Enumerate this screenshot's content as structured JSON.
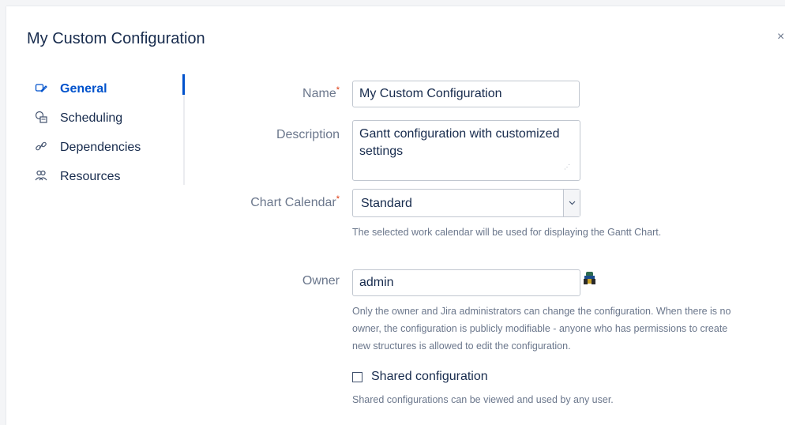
{
  "dialog": {
    "title": "My Custom Configuration",
    "close_glyph": "×"
  },
  "nav": {
    "items": [
      {
        "label": "General",
        "icon": "settings-pen-icon",
        "glyph": "⚙",
        "active": true
      },
      {
        "label": "Scheduling",
        "icon": "calendar-clock-icon",
        "glyph": "⏲"
      },
      {
        "label": "Dependencies",
        "icon": "link-icon",
        "glyph": "🔗"
      },
      {
        "label": "Resources",
        "icon": "people-icon",
        "glyph": "👥"
      }
    ]
  },
  "form": {
    "name": {
      "label": "Name",
      "required_mark": "*",
      "value": "My Custom Configuration"
    },
    "description": {
      "label": "Description",
      "value": "Gantt configuration with customized settings"
    },
    "chart_calendar": {
      "label": "Chart Calendar",
      "required_mark": "*",
      "selected": "Standard",
      "help": "The selected work calendar will be used for displaying the Gantt Chart."
    },
    "owner": {
      "label": "Owner",
      "value": "admin",
      "help_lines": [
        "Only the owner and Jira administrators can change the configuration. When there is no",
        "owner, the configuration is publicly modifiable - anyone who has permissions to create",
        "new structures is allowed to edit the configuration."
      ]
    },
    "shared": {
      "label": "Shared configuration",
      "checked": false,
      "help": "Shared configurations can be viewed and used by any user."
    }
  },
  "colors": {
    "accent": "#0052cc",
    "required": "#de350b",
    "muted": "#6b778c"
  }
}
